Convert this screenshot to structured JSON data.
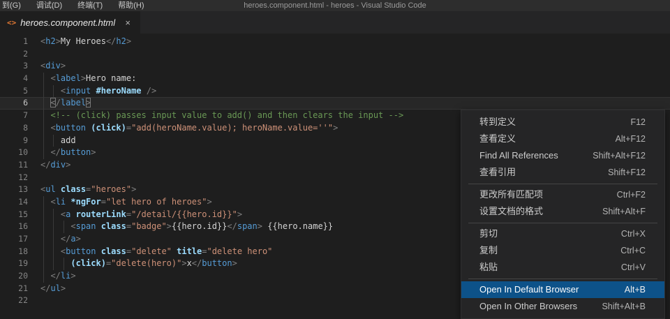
{
  "title_bar": {
    "menus": [
      {
        "label": "到(G)"
      },
      {
        "label": "调试(D)"
      },
      {
        "label": "终端(T)"
      },
      {
        "label": "帮助(H)"
      }
    ],
    "title": "heroes.component.html - heroes - Visual Studio Code"
  },
  "tab": {
    "icon": "<>",
    "label": "heroes.component.html",
    "close": "×"
  },
  "editor": {
    "current_line": 6,
    "lines": [
      {
        "n": 1,
        "t": [
          [
            "p",
            "<"
          ],
          [
            "t",
            "h2"
          ],
          [
            "p",
            ">"
          ],
          [
            "x",
            "My Heroes"
          ],
          [
            "p",
            "</"
          ],
          [
            "t",
            "h2"
          ],
          [
            "p",
            ">"
          ]
        ]
      },
      {
        "n": 2,
        "t": []
      },
      {
        "n": 3,
        "t": [
          [
            "p",
            "<"
          ],
          [
            "t",
            "div"
          ],
          [
            "p",
            ">"
          ]
        ]
      },
      {
        "n": 4,
        "t": [
          [
            "x",
            "  "
          ],
          [
            "p",
            "<"
          ],
          [
            "t",
            "label"
          ],
          [
            "p",
            ">"
          ],
          [
            "x",
            "Hero name:"
          ]
        ]
      },
      {
        "n": 5,
        "t": [
          [
            "x",
            "    "
          ],
          [
            "p",
            "<"
          ],
          [
            "t",
            "input"
          ],
          [
            "x",
            " "
          ],
          [
            "a",
            "#heroName"
          ],
          [
            "x",
            " "
          ],
          [
            "p",
            "/>"
          ]
        ]
      },
      {
        "n": 6,
        "t": [
          [
            "x",
            "  "
          ],
          [
            "b",
            "<"
          ],
          [
            "p",
            "/"
          ],
          [
            "t",
            "label"
          ],
          [
            "b",
            ">"
          ]
        ]
      },
      {
        "n": 7,
        "t": [
          [
            "x",
            "  "
          ],
          [
            "c",
            "<!-- (click) passes input value to add() and then clears the input -->"
          ]
        ]
      },
      {
        "n": 8,
        "t": [
          [
            "x",
            "  "
          ],
          [
            "p",
            "<"
          ],
          [
            "t",
            "button"
          ],
          [
            "x",
            " "
          ],
          [
            "a",
            "(click)"
          ],
          [
            "p",
            "="
          ],
          [
            "s",
            "\"add(heroName.value); heroName.value=''\""
          ],
          [
            "p",
            ">"
          ]
        ]
      },
      {
        "n": 9,
        "t": [
          [
            "x",
            "    add"
          ]
        ]
      },
      {
        "n": 10,
        "t": [
          [
            "x",
            "  "
          ],
          [
            "p",
            "</"
          ],
          [
            "t",
            "button"
          ],
          [
            "p",
            ">"
          ]
        ]
      },
      {
        "n": 11,
        "t": [
          [
            "p",
            "</"
          ],
          [
            "t",
            "div"
          ],
          [
            "p",
            ">"
          ]
        ]
      },
      {
        "n": 12,
        "t": []
      },
      {
        "n": 13,
        "t": [
          [
            "p",
            "<"
          ],
          [
            "t",
            "ul"
          ],
          [
            "x",
            " "
          ],
          [
            "a",
            "class"
          ],
          [
            "p",
            "="
          ],
          [
            "s",
            "\"heroes\""
          ],
          [
            "p",
            ">"
          ]
        ]
      },
      {
        "n": 14,
        "t": [
          [
            "x",
            "  "
          ],
          [
            "p",
            "<"
          ],
          [
            "t",
            "li"
          ],
          [
            "x",
            " "
          ],
          [
            "a",
            "*ngFor"
          ],
          [
            "p",
            "="
          ],
          [
            "s",
            "\"let hero of heroes\""
          ],
          [
            "p",
            ">"
          ]
        ]
      },
      {
        "n": 15,
        "t": [
          [
            "x",
            "    "
          ],
          [
            "p",
            "<"
          ],
          [
            "t",
            "a"
          ],
          [
            "x",
            " "
          ],
          [
            "a",
            "routerLink"
          ],
          [
            "p",
            "="
          ],
          [
            "s",
            "\"/detail/{{hero.id}}\""
          ],
          [
            "p",
            ">"
          ]
        ]
      },
      {
        "n": 16,
        "t": [
          [
            "x",
            "      "
          ],
          [
            "p",
            "<"
          ],
          [
            "t",
            "span"
          ],
          [
            "x",
            " "
          ],
          [
            "a",
            "class"
          ],
          [
            "p",
            "="
          ],
          [
            "s",
            "\"badge\""
          ],
          [
            "p",
            ">"
          ],
          [
            "x",
            "{{hero.id}}"
          ],
          [
            "p",
            "</"
          ],
          [
            "t",
            "span"
          ],
          [
            "p",
            ">"
          ],
          [
            "x",
            " {{hero.name}}"
          ]
        ]
      },
      {
        "n": 17,
        "t": [
          [
            "x",
            "    "
          ],
          [
            "p",
            "</"
          ],
          [
            "t",
            "a"
          ],
          [
            "p",
            ">"
          ]
        ]
      },
      {
        "n": 18,
        "t": [
          [
            "x",
            "    "
          ],
          [
            "p",
            "<"
          ],
          [
            "t",
            "button"
          ],
          [
            "x",
            " "
          ],
          [
            "a",
            "class"
          ],
          [
            "p",
            "="
          ],
          [
            "s",
            "\"delete\""
          ],
          [
            "x",
            " "
          ],
          [
            "a",
            "title"
          ],
          [
            "p",
            "="
          ],
          [
            "s",
            "\"delete hero\""
          ]
        ]
      },
      {
        "n": 19,
        "t": [
          [
            "x",
            "      "
          ],
          [
            "a",
            "(click)"
          ],
          [
            "p",
            "="
          ],
          [
            "s",
            "\"delete(hero)\""
          ],
          [
            "p",
            ">"
          ],
          [
            "x",
            "x"
          ],
          [
            "p",
            "</"
          ],
          [
            "t",
            "button"
          ],
          [
            "p",
            ">"
          ]
        ]
      },
      {
        "n": 20,
        "t": [
          [
            "x",
            "  "
          ],
          [
            "p",
            "</"
          ],
          [
            "t",
            "li"
          ],
          [
            "p",
            ">"
          ]
        ]
      },
      {
        "n": 21,
        "t": [
          [
            "p",
            "</"
          ],
          [
            "t",
            "ul"
          ],
          [
            "p",
            ">"
          ]
        ]
      },
      {
        "n": 22,
        "t": []
      }
    ]
  },
  "context_menu": {
    "items": [
      {
        "type": "item",
        "label": "转到定义",
        "shortcut": "F12"
      },
      {
        "type": "item",
        "label": "查看定义",
        "shortcut": "Alt+F12"
      },
      {
        "type": "item",
        "label": "Find All References",
        "shortcut": "Shift+Alt+F12"
      },
      {
        "type": "item",
        "label": "查看引用",
        "shortcut": "Shift+F12"
      },
      {
        "type": "separator"
      },
      {
        "type": "item",
        "label": "更改所有匹配项",
        "shortcut": "Ctrl+F2"
      },
      {
        "type": "item",
        "label": "设置文档的格式",
        "shortcut": "Shift+Alt+F"
      },
      {
        "type": "separator"
      },
      {
        "type": "item",
        "label": "剪切",
        "shortcut": "Ctrl+X"
      },
      {
        "type": "item",
        "label": "复制",
        "shortcut": "Ctrl+C"
      },
      {
        "type": "item",
        "label": "粘贴",
        "shortcut": "Ctrl+V"
      },
      {
        "type": "separator"
      },
      {
        "type": "item",
        "label": "Open In Default Browser",
        "shortcut": "Alt+B",
        "selected": true
      },
      {
        "type": "item",
        "label": "Open In Other Browsers",
        "shortcut": "Shift+Alt+B"
      }
    ]
  },
  "colors": {
    "menu_highlight": "#0d5289",
    "tab_icon": "#e37933",
    "tag": "#569cd6",
    "attribute": "#9cdcfe",
    "string": "#ce9178",
    "comment": "#6a9955",
    "punctuation": "#808080",
    "text": "#d4d4d4",
    "editor_background": "#1e1e1e"
  }
}
